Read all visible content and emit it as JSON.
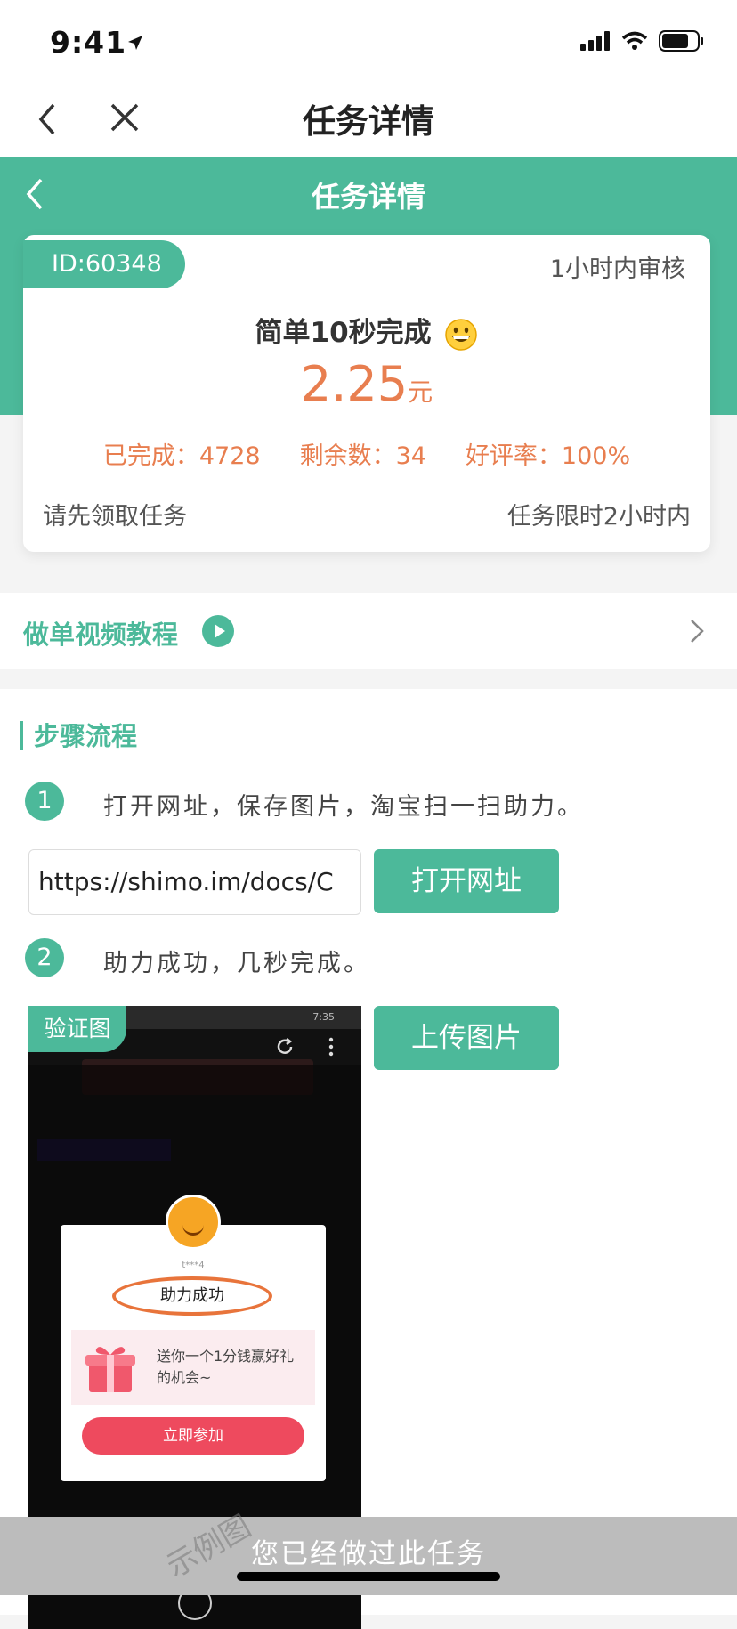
{
  "status_bar": {
    "time": "9:41",
    "battery_level": 0.75
  },
  "nav": {
    "title": "任务详情"
  },
  "header": {
    "title": "任务详情"
  },
  "task": {
    "id": "ID:60348",
    "review_time": "1小时内审核",
    "name": "简单10秒完成",
    "emoji": "grinning-face-icon",
    "price": "2.25",
    "price_unit": "元",
    "completed": "已完成：4728",
    "remaining": "剩余数：34",
    "rating": "好评率：100%",
    "hint": "请先领取任务",
    "time_limit": "任务限时2小时内"
  },
  "tutorial": {
    "label": "做单视频教程"
  },
  "steps": {
    "title": "步骤流程",
    "items": [
      {
        "num": "1",
        "text": "打开网址，保存图片，淘宝扫一扫助力。"
      },
      {
        "num": "2",
        "text": "助力成功，几秒完成。"
      }
    ],
    "url_value": "https://shimo.im/docs/C",
    "open_button": "打开网址",
    "upload_button": "上传图片",
    "proof_label": "验证图",
    "proof_image": {
      "status_time": "7:35",
      "user": "t***4",
      "success_text": "助力成功",
      "gift_text": "送你一个1分钱赢好礼的机会~",
      "join_button": "立即参加",
      "watermark": "示例图"
    }
  },
  "bottom": {
    "label": "您已经做过此任务"
  },
  "colors": {
    "accent": "#4cb99a",
    "price": "#e87e4f",
    "disabled": "#bcbcbc"
  }
}
